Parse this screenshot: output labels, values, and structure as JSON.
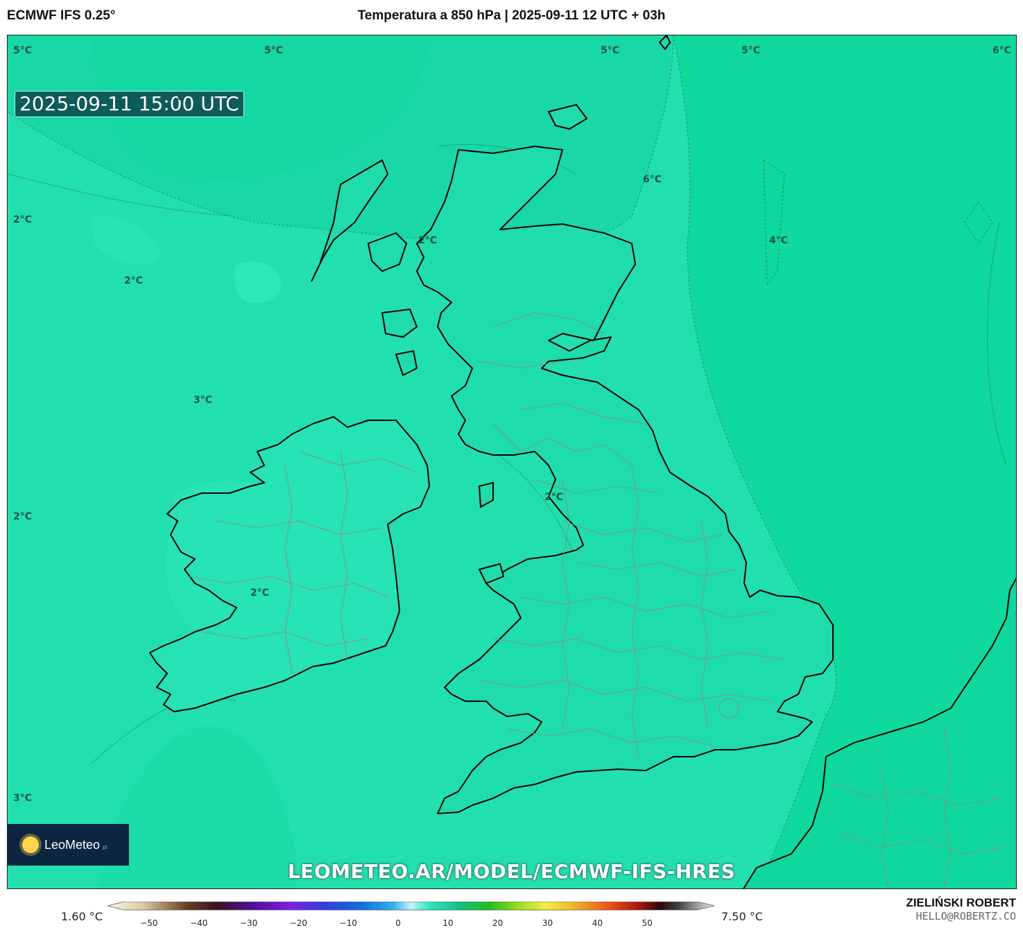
{
  "header": {
    "model": "ECMWF IFS 0.25°",
    "title": "Temperatura a 850 hPa | 2025-09-11 12 UTC + 03h"
  },
  "map": {
    "valid_time": "2025-09-11 15:00 UTC",
    "contour_labels": [
      "5°C",
      "5°C",
      "5°C",
      "5°C",
      "6°C",
      "4°C",
      "2°C",
      "2°C",
      "6°C",
      "4°C",
      "2°C",
      "3°C",
      "2°C",
      "2°C",
      "2°C",
      "3°C"
    ],
    "colors": {
      "cold_field": "#22dfae",
      "warm_field": "#0fd99d",
      "coast": "#000000",
      "borders": "#8a8a8a"
    }
  },
  "branding": {
    "logo": "LeoMeteo",
    "logo_tld": ".pl",
    "url": "LEOMETEO.AR/MODEL/ECMWF-IFS-HRES"
  },
  "colorbar": {
    "min_label": "1.60 °C",
    "max_label": "7.50 °C",
    "ticks": [
      "−50",
      "−40",
      "−30",
      "−20",
      "−10",
      "0",
      "10",
      "20",
      "30",
      "40",
      "50"
    ],
    "tick_values": [
      -50,
      -40,
      -30,
      -20,
      -10,
      0,
      10,
      20,
      30,
      40,
      50
    ],
    "range": [
      -55,
      60
    ]
  },
  "author": {
    "name": "ZIELIŃSKI ROBERT",
    "email": "HELLO@ROBERTZ.CO"
  }
}
